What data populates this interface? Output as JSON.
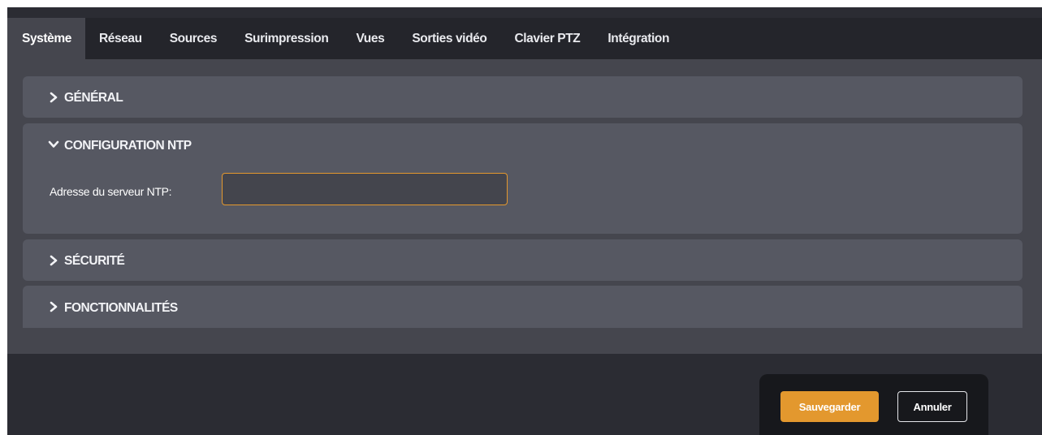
{
  "tabs": [
    {
      "label": "Système",
      "active": true
    },
    {
      "label": "Réseau"
    },
    {
      "label": "Sources"
    },
    {
      "label": "Surimpression"
    },
    {
      "label": "Vues"
    },
    {
      "label": "Sorties vidéo"
    },
    {
      "label": "Clavier PTZ"
    },
    {
      "label": "Intégration"
    }
  ],
  "sections": {
    "general": {
      "title": "GÉNÉRAL",
      "expanded": false
    },
    "ntp": {
      "title": "CONFIGURATION NTP",
      "expanded": true,
      "server_label": "Adresse du serveur NTP:",
      "server_value": ""
    },
    "security": {
      "title": "SÉCURITÉ",
      "expanded": false
    },
    "features": {
      "title": "FONCTIONNALITÉS",
      "expanded": false
    }
  },
  "actions": {
    "save_label": "Sauvegarder",
    "cancel_label": "Annuler"
  },
  "colors": {
    "accent": "#e3982e",
    "tabbar": "#24252b",
    "panel": "#565862",
    "content": "#45464e"
  },
  "icons": {
    "collapsed": "chevron-right-icon",
    "expanded": "chevron-down-icon"
  }
}
